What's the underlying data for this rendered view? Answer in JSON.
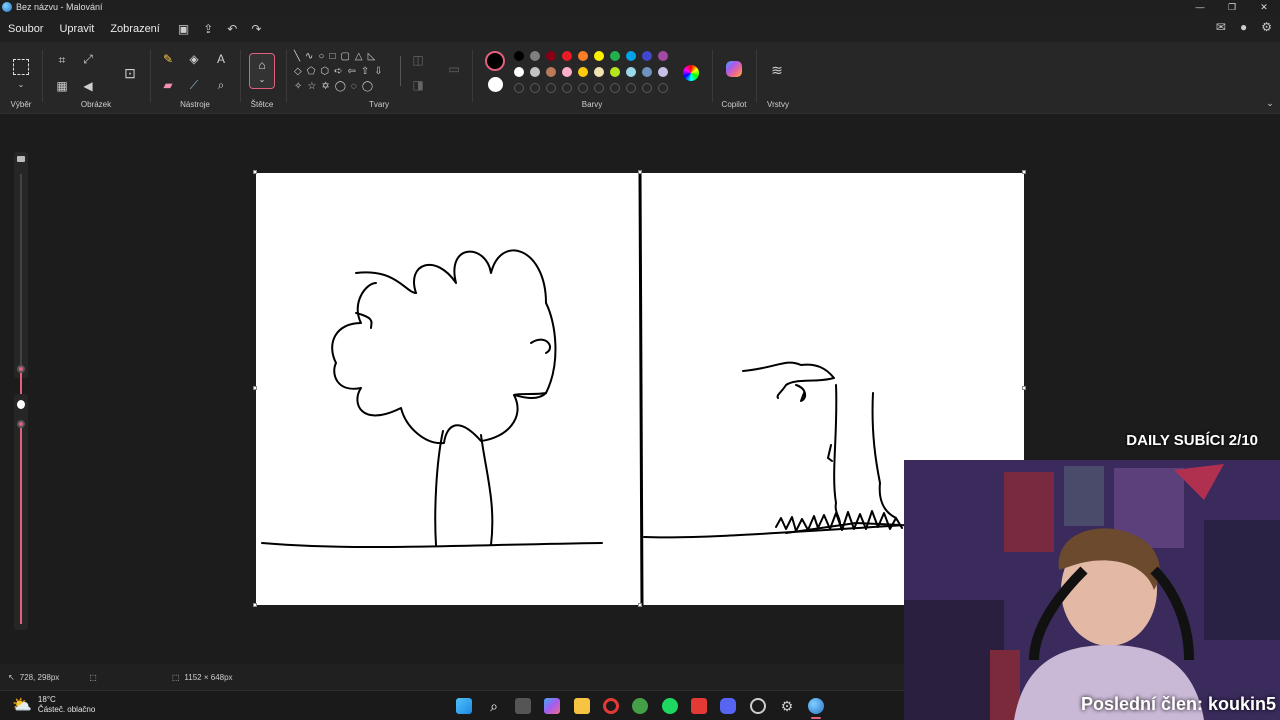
{
  "window": {
    "title": "Bez názvu - Malování"
  },
  "menu": {
    "file": "Soubor",
    "edit": "Upravit",
    "view": "Zobrazení"
  },
  "ribbon": {
    "selection": "Výběr",
    "image": "Obrázek",
    "tools": "Nástroje",
    "brushes": "Štětce",
    "shapes": "Tvary",
    "colors": "Barvy",
    "copilot": "Copilot",
    "layers": "Vrstvy"
  },
  "palette": {
    "row1": [
      "#000000",
      "#7f7f7f",
      "#880015",
      "#ed1c24",
      "#ff7f27",
      "#fff200",
      "#22b14c",
      "#00a2e8",
      "#3f48cc",
      "#a349a4"
    ],
    "row2": [
      "#ffffff",
      "#c3c3c3",
      "#b97a57",
      "#ffaec9",
      "#ffc90e",
      "#efe4b0",
      "#b5e61d",
      "#99d9ea",
      "#7092be",
      "#c8bfe7"
    ],
    "primary": "#000000",
    "secondary": "#ffffff"
  },
  "status": {
    "cursor_position": "728, 298px",
    "canvas_size": "1152 × 648px"
  },
  "weather": {
    "temp": "18°C",
    "desc": "Částeč. oblačno"
  },
  "stream": {
    "top_banner": "DAILY SUBÍCI 2/10",
    "bottom_banner": "Poslední člen: koukin5"
  }
}
